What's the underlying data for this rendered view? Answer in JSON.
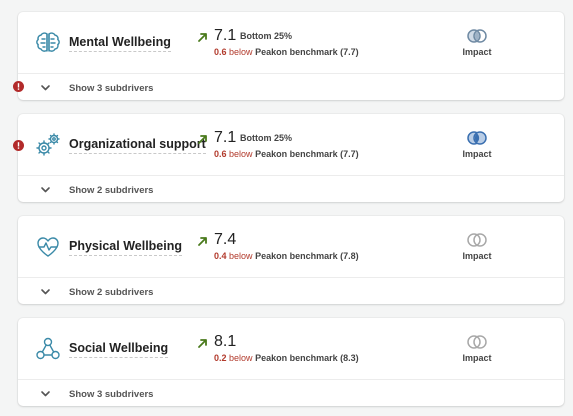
{
  "colors": {
    "trend_up": "#4a7a1c",
    "below": "#b23a2c",
    "icon": "#3b8aa8",
    "alert": "#b22a2a",
    "impact_high": "#3a6fb0",
    "impact_mid": "#6f8aa3",
    "impact_low": "#9a9a9a"
  },
  "drivers": [
    {
      "name": "Mental Wellbeing",
      "icon": "brain-icon",
      "trend": "up",
      "score": "7.1",
      "rank": "Bottom 25%",
      "diff": "0.6",
      "diff_word": "below",
      "benchmark": "Peakon benchmark (7.7)",
      "impact_label": "Impact",
      "impact_level": "medium",
      "subdrivers": "Show 3 subdrivers",
      "alert": true
    },
    {
      "name": "Organizational support",
      "icon": "gears-icon",
      "trend": "up",
      "score": "7.1",
      "rank": "Bottom 25%",
      "diff": "0.6",
      "diff_word": "below",
      "benchmark": "Peakon benchmark (7.7)",
      "impact_label": "Impact",
      "impact_level": "high",
      "subdrivers": "Show 2 subdrivers",
      "alert": true
    },
    {
      "name": "Physical Wellbeing",
      "icon": "heartbeat-icon",
      "trend": "up",
      "score": "7.4",
      "rank": "",
      "diff": "0.4",
      "diff_word": "below",
      "benchmark": "Peakon benchmark (7.8)",
      "impact_label": "Impact",
      "impact_level": "low",
      "subdrivers": "Show 2 subdrivers",
      "alert": false
    },
    {
      "name": "Social Wellbeing",
      "icon": "people-network-icon",
      "trend": "up",
      "score": "8.1",
      "rank": "",
      "diff": "0.2",
      "diff_word": "below",
      "benchmark": "Peakon benchmark (8.3)",
      "impact_label": "Impact",
      "impact_level": "low",
      "subdrivers": "Show 3 subdrivers",
      "alert": false
    }
  ]
}
